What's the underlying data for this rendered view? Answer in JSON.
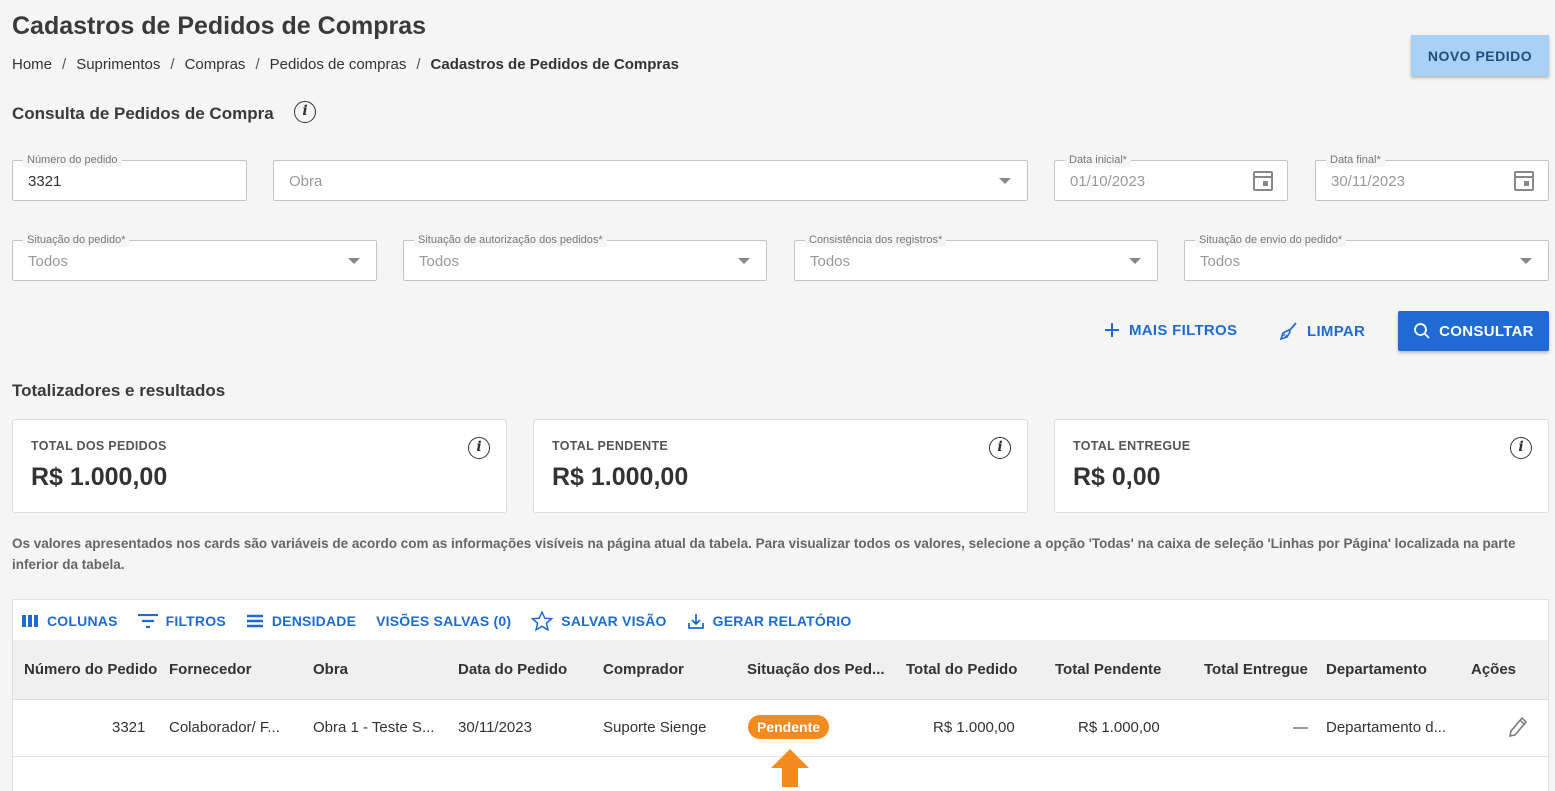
{
  "page": {
    "title": "Cadastros de Pedidos de Compras",
    "breadcrumb": [
      "Home",
      "Suprimentos",
      "Compras",
      "Pedidos de compras",
      "Cadastros de Pedidos de Compras"
    ],
    "new_button": "NOVO PEDIDO"
  },
  "query": {
    "title": "Consulta de Pedidos de Compra",
    "info_glyph": "i",
    "fields": {
      "numero": {
        "label": "Número do pedido",
        "value": "3321"
      },
      "obra": {
        "placeholder": "Obra"
      },
      "data_inicial": {
        "label": "Data inicial*",
        "value": "01/10/2023"
      },
      "data_final": {
        "label": "Data final*",
        "value": "30/11/2023"
      },
      "situacao": {
        "label": "Situação do pedido*",
        "value": "Todos"
      },
      "autorizacao": {
        "label": "Situação de autorização dos pedidos*",
        "value": "Todos"
      },
      "consistencia": {
        "label": "Consistência dos registros*",
        "value": "Todos"
      },
      "envio": {
        "label": "Situação de envio do pedido*",
        "value": "Todos"
      }
    },
    "actions": {
      "more_filters": "MAIS FILTROS",
      "clear": "LIMPAR",
      "search": "CONSULTAR"
    }
  },
  "totals": {
    "title": "Totalizadores e resultados",
    "cards": [
      {
        "label": "TOTAL DOS PEDIDOS",
        "value": "R$ 1.000,00"
      },
      {
        "label": "TOTAL PENDENTE",
        "value": "R$ 1.000,00"
      },
      {
        "label": "TOTAL ENTREGUE",
        "value": "R$ 0,00"
      }
    ],
    "note": "Os valores apresentados nos cards são variáveis de acordo com as informações visíveis na página atual da tabela. Para visualizar todos os valores, selecione a opção 'Todas' na caixa de seleção 'Linhas por Página' localizada na parte inferior da tabela."
  },
  "table": {
    "toolbar": [
      "COLUNAS",
      "FILTROS",
      "DENSIDADE",
      "VISÕES SALVAS (0)",
      "SALVAR VISÃO",
      "GERAR RELATÓRIO"
    ],
    "columns": [
      "Número do Pedido",
      "Fornecedor",
      "Obra",
      "Data do Pedido",
      "Comprador",
      "Situação dos Ped...",
      "Total do Pedido",
      "Total Pendente",
      "Total Entregue",
      "Departamento",
      "Ações"
    ],
    "rows": [
      {
        "numero": "3321",
        "fornecedor": "Colaborador/ F...",
        "obra": "Obra 1 - Teste S...",
        "data": "30/11/2023",
        "comprador": "Suporte Sienge",
        "situacao": "Pendente",
        "total": "R$ 1.000,00",
        "pendente": "R$ 1.000,00",
        "entregue": "—",
        "departamento": "Departamento d..."
      }
    ]
  },
  "colors": {
    "primary": "#1f6bd1",
    "badge_pending": "#f58a1f",
    "arrow": "#f58a1f",
    "new_button_bg": "#a9d0f5"
  }
}
